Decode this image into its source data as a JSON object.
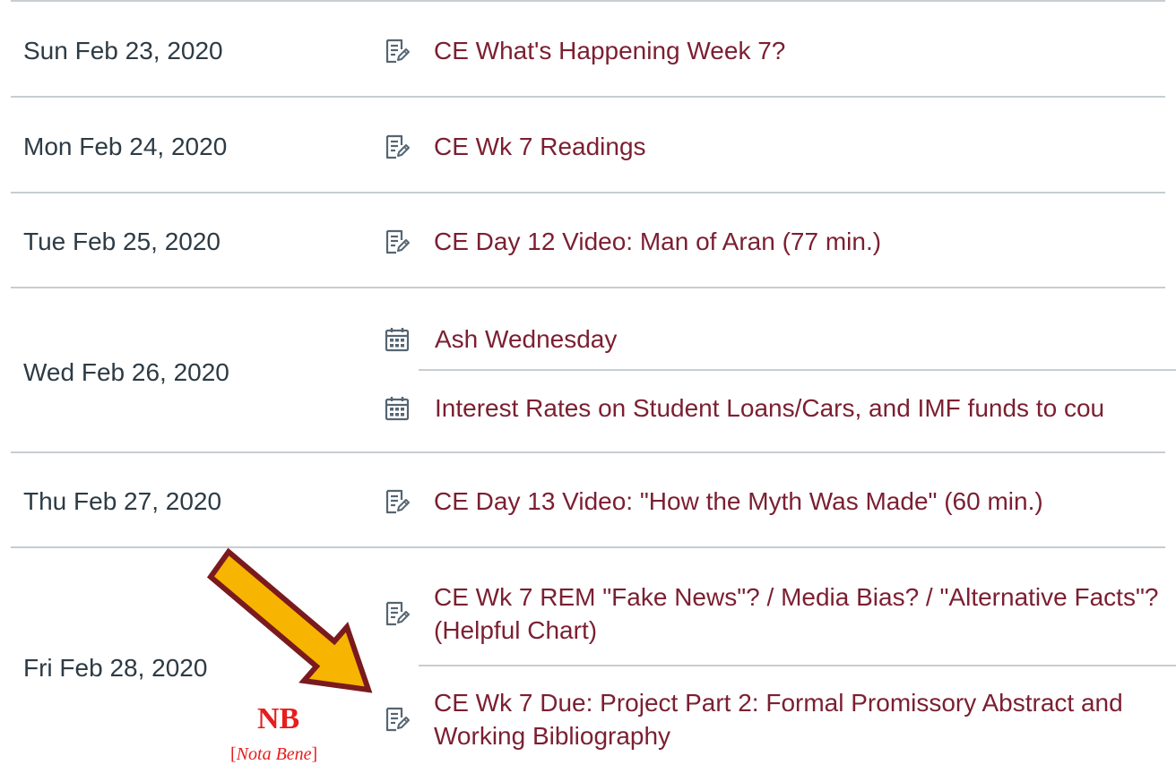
{
  "colors": {
    "link": "#7b1f31",
    "date_text": "#2d3b45",
    "divider": "#c7cdd1",
    "icon": "#556572",
    "arrow_fill": "#f7b400",
    "arrow_outline": "#7a1a1e",
    "note": "#e61e1e"
  },
  "days": [
    {
      "date": "Sun Feb 23, 2020",
      "events": [
        {
          "icon": "assignment-icon",
          "title": "CE What's Happening Week 7?"
        }
      ]
    },
    {
      "date": "Mon Feb 24, 2020",
      "events": [
        {
          "icon": "assignment-icon",
          "title": "CE Wk 7 Readings"
        }
      ]
    },
    {
      "date": "Tue Feb 25, 2020",
      "events": [
        {
          "icon": "assignment-icon",
          "title": "CE Day 12 Video: Man of Aran (77 min.)"
        }
      ]
    },
    {
      "date": "Wed Feb 26, 2020",
      "events": [
        {
          "icon": "calendar-icon",
          "title": "Ash Wednesday"
        },
        {
          "icon": "calendar-icon",
          "title": "Interest Rates on Student Loans/Cars, and IMF funds to cou"
        }
      ]
    },
    {
      "date": "Thu Feb 27, 2020",
      "events": [
        {
          "icon": "assignment-icon",
          "title": "CE Day 13 Video: \"How the Myth Was Made\" (60 min.)"
        }
      ]
    },
    {
      "date": "Fri Feb 28, 2020",
      "events": [
        {
          "icon": "assignment-icon",
          "title": "CE Wk 7 REM \"Fake News\"? / Media Bias? / \"Alternative Facts\"? (Helpful Chart)"
        },
        {
          "icon": "assignment-icon",
          "title": "CE Wk 7 Due: Project Part 2: Formal Promissory Abstract and Working Bibliography"
        }
      ]
    }
  ],
  "annotation": {
    "label": "NB",
    "sub_open": "[",
    "sub_italic": "Nota Bene",
    "sub_close": "]"
  }
}
